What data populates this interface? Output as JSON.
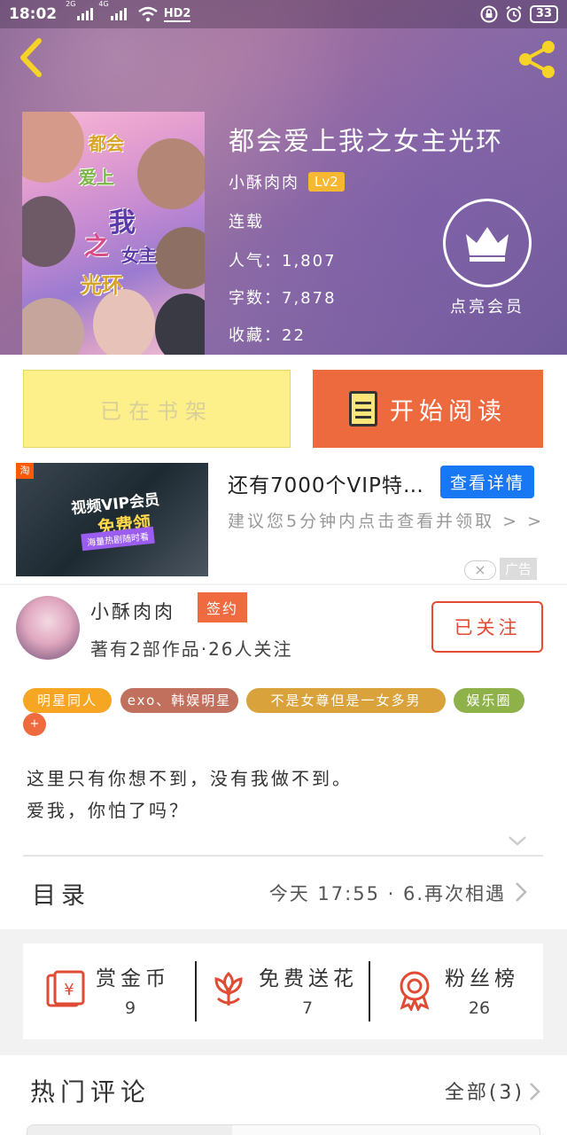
{
  "status_bar": {
    "time": "18:02",
    "network_1": "2G",
    "network_2": "4G",
    "hd_label": "HD2",
    "battery": "33"
  },
  "book": {
    "title": "都会爱上我之女主光环",
    "author": "小酥肉肉",
    "level": "Lv2",
    "status": "连载",
    "popularity": "人气：1,807",
    "word_count": "字数：7,878",
    "favorites": "收藏：22",
    "vip_label": "点亮会员",
    "cover_lines": [
      "都会",
      "爱上",
      "我",
      "之",
      "女主",
      "光环"
    ]
  },
  "actions": {
    "on_shelf_label": "已在书架",
    "start_reading_label": "开始阅读"
  },
  "ad": {
    "title": "还有7000个VIP特…",
    "button_label": "查看详情",
    "description": "建议您5分钟内点击查看并领取 > >",
    "tag": "广告",
    "image_lines": [
      "视频VIP会员",
      "免费领",
      "海量热剧随时看"
    ],
    "taobao_badge": "淘"
  },
  "author_section": {
    "name": "小酥肉肉",
    "sign_badge": "签约",
    "stats": "著有2部作品·26人关注",
    "follow_label": "已关注"
  },
  "tags": [
    {
      "label": "明星同人",
      "color": "#f6a623"
    },
    {
      "label": "exo、韩娱明星",
      "color": "#c0705c"
    },
    {
      "label": "不是女尊但是一女多男",
      "color": "#d9a23b"
    },
    {
      "label": "娱乐圈",
      "color": "#8eb14a"
    }
  ],
  "tag_more": "+",
  "intro": {
    "line1": "这里只有你想不到，没有我做不到。",
    "line2": "爱我，你怕了吗？"
  },
  "toc": {
    "label": "目录",
    "latest": "今天 17:55 · 6.再次相遇"
  },
  "rewards": [
    {
      "label": "赏金币",
      "count": "9",
      "icon": "coin-envelope-icon"
    },
    {
      "label": "免费送花",
      "count": "7",
      "icon": "flower-icon"
    },
    {
      "label": "粉丝榜",
      "count": "26",
      "icon": "medal-icon"
    }
  ],
  "comments": {
    "title": "热门评论",
    "all_label": "全部(3)"
  },
  "colors": {
    "accent_orange": "#ed6a3f",
    "shelf_yellow": "#fdf08a",
    "follow_red": "#e44b33",
    "vip_blue": "#1877f2"
  }
}
